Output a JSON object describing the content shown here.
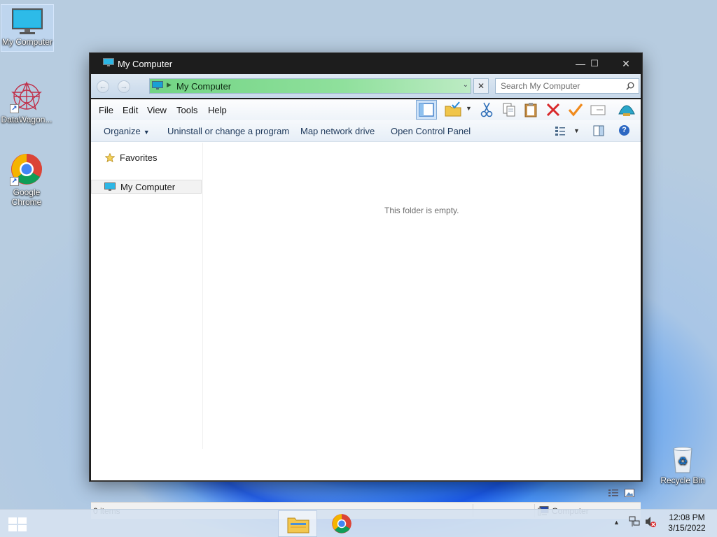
{
  "desktop": {
    "icons": [
      {
        "label": "My Computer"
      },
      {
        "label": "DataWagon..."
      },
      {
        "label": "Google Chrome"
      },
      {
        "label": "Recycle Bin"
      }
    ]
  },
  "window": {
    "title": "My Computer",
    "controls": {
      "minimize": "—",
      "maximize": "☐",
      "close": "✕"
    },
    "address": {
      "location": "My Computer",
      "clear": "✕"
    },
    "search": {
      "placeholder": "Search My Computer"
    },
    "menu": [
      "File",
      "Edit",
      "View",
      "Tools",
      "Help"
    ],
    "commands": {
      "organize": "Organize",
      "uninstall": "Uninstall or change a program",
      "map_drive": "Map network drive",
      "control_panel": "Open Control Panel"
    },
    "nav": {
      "favorites": "Favorites",
      "my_computer": "My Computer"
    },
    "content": {
      "empty_message": "This folder is empty."
    },
    "status": {
      "items": "0 items",
      "location": "Computer"
    }
  },
  "taskbar": {
    "clock_time": "12:08 PM",
    "clock_date": "3/15/2022"
  },
  "colors": {
    "address_green": "#8fe09c",
    "title_bar": "#1d1d1d",
    "command_text": "#1e395b"
  }
}
